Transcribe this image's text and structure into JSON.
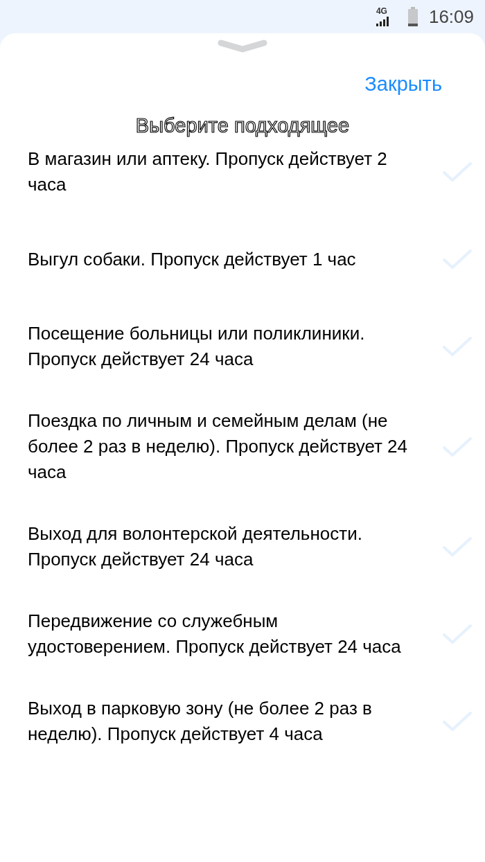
{
  "status_bar": {
    "network": "4G",
    "time": "16:09"
  },
  "sheet": {
    "close": "Закрыть",
    "title": "Выберите подходящее",
    "options": [
      {
        "label": "В магазин или аптеку. Пропуск действует 2 часа",
        "selected": false
      },
      {
        "label": "Выгул собаки. Пропуск действует 1 час",
        "selected": false
      },
      {
        "label": "Посещение больницы или поликлиники. Пропуск действует 24 часа",
        "selected": false
      },
      {
        "label": "Поездка по личным и семейным делам (не более 2 раз в неделю). Пропуск действует 24 часа",
        "selected": false
      },
      {
        "label": "Выход для волонтерской деятельности. Пропуск действует 24 часа",
        "selected": false
      },
      {
        "label": "Передвижение со служебным удостоверением. Пропуск действует 24 часа",
        "selected": false
      },
      {
        "label": "Выход в парковую зону (не более 2 раз в неделю). Пропуск действует 4 часа",
        "selected": false
      }
    ]
  }
}
